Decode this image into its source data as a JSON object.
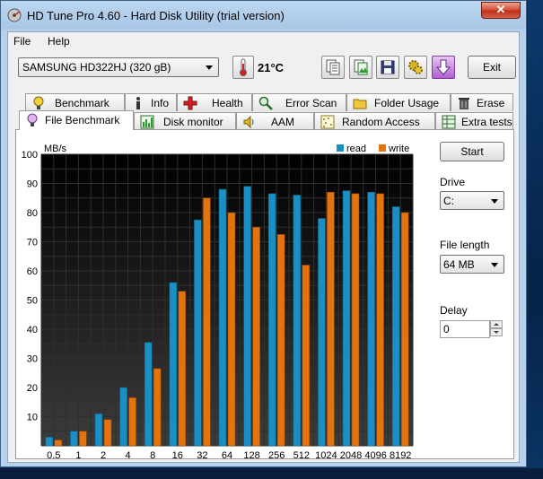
{
  "window": {
    "title": "HD Tune Pro 4.60 - Hard Disk Utility (trial version)",
    "close_label": "✕"
  },
  "menu": [
    {
      "label": "File"
    },
    {
      "label": "Help"
    }
  ],
  "toolbar": {
    "drive": "SAMSUNG HD322HJ (320 gB)",
    "temperature": "21°C",
    "exit_label": "Exit"
  },
  "tabs_top": [
    {
      "label": "Benchmark",
      "icon": "benchmark-icon"
    },
    {
      "label": "Info",
      "icon": "info-icon"
    },
    {
      "label": "Health",
      "icon": "health-icon"
    },
    {
      "label": "Error Scan",
      "icon": "error-scan-icon"
    },
    {
      "label": "Folder Usage",
      "icon": "folder-icon"
    },
    {
      "label": "Erase",
      "icon": "trash-icon"
    }
  ],
  "tabs_bottom": [
    {
      "label": "File Benchmark",
      "icon": "file-benchmark-icon",
      "active": true
    },
    {
      "label": "Disk monitor",
      "icon": "disk-monitor-icon"
    },
    {
      "label": "AAM",
      "icon": "speaker-icon"
    },
    {
      "label": "Random Access",
      "icon": "random-access-icon"
    },
    {
      "label": "Extra tests",
      "icon": "extra-tests-icon"
    }
  ],
  "side": {
    "start_label": "Start",
    "drive_label": "Drive",
    "drive_value": "C:",
    "file_length_label": "File length",
    "file_length_value": "64 MB",
    "delay_label": "Delay",
    "delay_value": "0"
  },
  "colors": {
    "read": "#1a8fc4",
    "write": "#e2740f"
  },
  "chart_data": {
    "type": "bar",
    "ylabel": "MB/s",
    "ylim": [
      0,
      100
    ],
    "yticks": [
      10,
      20,
      30,
      40,
      50,
      60,
      70,
      80,
      90,
      100
    ],
    "categories": [
      "0.5",
      "1",
      "2",
      "4",
      "8",
      "16",
      "32",
      "64",
      "128",
      "256",
      "512",
      "1024",
      "2048",
      "4096",
      "8192"
    ],
    "series": [
      {
        "name": "read",
        "values": [
          3,
          5,
          11,
          20,
          35.5,
          56,
          77.5,
          88,
          89,
          86.5,
          86,
          78,
          87.5,
          87,
          82
        ]
      },
      {
        "name": "write",
        "values": [
          2,
          5,
          9,
          16.5,
          26.5,
          53,
          85,
          80,
          75,
          72.5,
          62,
          87,
          86.5,
          86.5,
          80
        ]
      }
    ],
    "legend": "top-right",
    "grid": true
  }
}
